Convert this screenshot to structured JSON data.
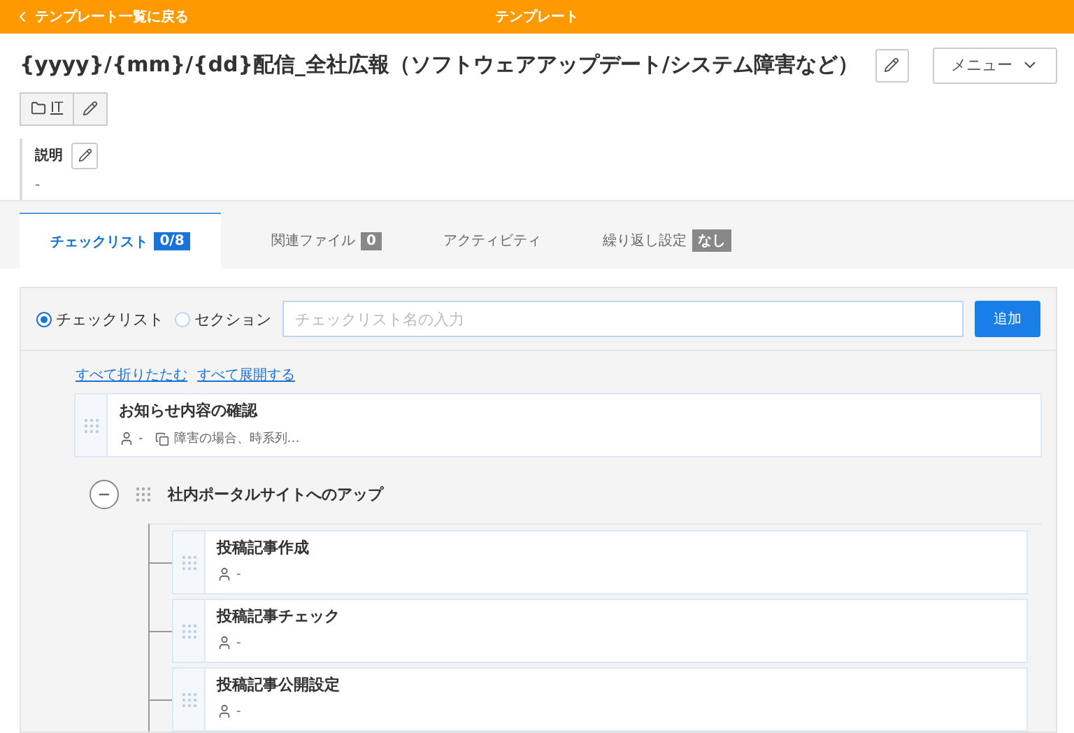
{
  "header": {
    "back_link": "テンプレート一覧に戻る",
    "title": "テンプレート"
  },
  "template": {
    "title": "{yyyy}/{mm}/{dd}配信_全社広報（ソフトウェアアップデート/システム障害など）",
    "menu": "メニュー",
    "folder": "IT",
    "description_label": "説明",
    "description": "-"
  },
  "tabs": [
    {
      "label": "チェックリスト",
      "badge": "0/8",
      "selected": true
    },
    {
      "label": "関連ファイル",
      "badge": "0",
      "selected": false
    },
    {
      "label": "アクティビティ",
      "selected": false
    },
    {
      "label": "繰り返し設定",
      "badge": "なし",
      "selected": false
    }
  ],
  "form": {
    "radios": [
      {
        "label": "チェックリスト",
        "selected": true
      },
      {
        "label": "セクション",
        "selected": false
      }
    ],
    "placeholder": "チェックリスト名の入力",
    "add_button": "追加"
  },
  "links": [
    "すべて折りたたむ",
    "すべて展開する"
  ],
  "items": [
    {
      "kind": "task",
      "title": "お知らせ内容の確認",
      "assignee": "-",
      "note": "障害の場合、時系列…"
    },
    {
      "kind": "section",
      "title": "社内ポータルサイトへのアップ",
      "expanded": true,
      "children": [
        {
          "kind": "task",
          "title": "投稿記事作成",
          "assignee": "-"
        },
        {
          "kind": "task",
          "title": "投稿記事チェック",
          "assignee": "-"
        },
        {
          "kind": "task",
          "title": "投稿記事公開設定",
          "assignee": "-"
        }
      ]
    }
  ]
}
